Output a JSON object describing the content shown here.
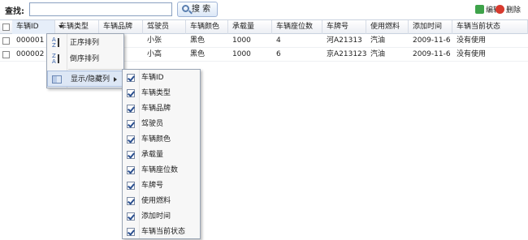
{
  "toolbar": {
    "search_label": "查找:",
    "search_value": "",
    "search_button": "搜 索",
    "edit": "编辑",
    "delete": "删除"
  },
  "columns": [
    "车辆ID",
    "车辆类型",
    "车辆品牌",
    "驾驶员",
    "车辆颜色",
    "承载量",
    "车辆座位数",
    "车牌号",
    "使用燃料",
    "添加时间",
    "车辆当前状态"
  ],
  "rows": [
    [
      "000001",
      "",
      "",
      "小张",
      "黑色",
      "1000",
      "4",
      "河A21313",
      "汽油",
      "2009-11-6",
      "没有使用"
    ],
    [
      "000002",
      "",
      "",
      "小高",
      "黑色",
      "1000",
      "6",
      "京A213123",
      "汽油",
      "2009-11-6",
      "没有使用"
    ]
  ],
  "menu": {
    "sort_asc": "正序排列",
    "sort_desc": "倒序排列",
    "show_hide": "显示/隐藏列"
  },
  "submenu": [
    "车辆ID",
    "车辆类型",
    "车辆品牌",
    "驾驶员",
    "车辆颜色",
    "承载量",
    "车辆座位数",
    "车牌号",
    "使用燃料",
    "添加时间",
    "车辆当前状态"
  ]
}
